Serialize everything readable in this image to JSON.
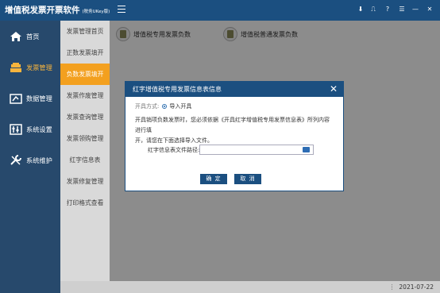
{
  "app": {
    "title": "增值税发票开票软件",
    "subtitle": "(税务UKey版)"
  },
  "topbar": {
    "icons": [
      "arrow-down-icon",
      "book-icon",
      "help-icon",
      "menu-icon",
      "minimize-icon",
      "close-icon"
    ],
    "glyphs": [
      "⬇",
      "⎍",
      "?",
      "☰",
      "—",
      "✕"
    ]
  },
  "nav": {
    "items": [
      {
        "label": "首页",
        "icon": "home-icon"
      },
      {
        "label": "发票管理",
        "icon": "invoice-icon",
        "active": true
      },
      {
        "label": "数据管理",
        "icon": "data-icon"
      },
      {
        "label": "系统设置",
        "icon": "settings-icon"
      },
      {
        "label": "系统维护",
        "icon": "maintenance-icon"
      }
    ]
  },
  "submenu": {
    "items": [
      {
        "label": "发票管理首页"
      },
      {
        "label": "正数发票填开"
      },
      {
        "label": "负数发票填开",
        "active": true
      },
      {
        "label": "发票作废管理"
      },
      {
        "label": "发票查询管理"
      },
      {
        "label": "发票领购管理"
      },
      {
        "label": "红字信息表"
      },
      {
        "label": "发票修复管理"
      },
      {
        "label": "打印格式查看"
      }
    ]
  },
  "main": {
    "invoice_types": [
      {
        "label": "增值税专用发票负数"
      },
      {
        "label": "增值税普通发票负数"
      }
    ]
  },
  "dialog": {
    "title": "红字增值税专用发票信息表信息",
    "mode_label": "开具方式:",
    "mode_value": "导入开具",
    "notice_line1": "开具销项负数发票时，您必须依据《开具红字增值税专用发票信息表》所列内容进行填",
    "notice_line2": "开，请您在下面选择导入文件。",
    "path_label": "红字信息表文件路径:",
    "path_value": "",
    "confirm": "确 定",
    "cancel": "取 消"
  },
  "status": {
    "date": "2021-07-22"
  }
}
